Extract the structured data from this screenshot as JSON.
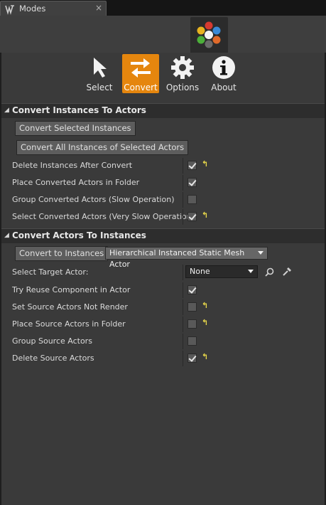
{
  "tab": {
    "title": "Modes",
    "close": "×"
  },
  "toolbar": {
    "tools": [
      {
        "label": "Select"
      },
      {
        "label": "Convert"
      },
      {
        "label": "Options"
      },
      {
        "label": "About"
      }
    ]
  },
  "section1": {
    "title": "Convert Instances To Actors",
    "buttons": [
      "Convert Selected Instances",
      "Convert All Instances of Selected Actors"
    ],
    "rows": [
      {
        "label": "Delete Instances After Convert",
        "checked": true,
        "reset": true
      },
      {
        "label": "Place Converted Actors in Folder",
        "checked": true,
        "reset": false
      },
      {
        "label": "Group Converted Actors (Slow Operation)",
        "checked": false,
        "reset": false
      },
      {
        "label": "Select Converted Actors (Very Slow Operation)",
        "checked": true,
        "reset": true
      }
    ]
  },
  "section2": {
    "title": "Convert Actors To Instances",
    "convert_button": "Convert to Instances",
    "type_combo": "Hierarchical Instanced Static Mesh Actor",
    "target_label": "Select Target Actor:",
    "target_value": "None",
    "rows": [
      {
        "label": "Try Reuse Component in Actor",
        "checked": true,
        "reset": false
      },
      {
        "label": "Set Source Actors Not Render",
        "checked": false,
        "reset": true
      },
      {
        "label": "Place Source Actors in Folder",
        "checked": false,
        "reset": true
      },
      {
        "label": "Group Source Actors",
        "checked": false,
        "reset": false
      },
      {
        "label": "Delete Source Actors",
        "checked": true,
        "reset": true
      }
    ]
  },
  "reset_glyph": "↰",
  "colors": {
    "accent": "#e5860e",
    "panel": "#3a3a3a",
    "reset": "#e8d84a"
  }
}
